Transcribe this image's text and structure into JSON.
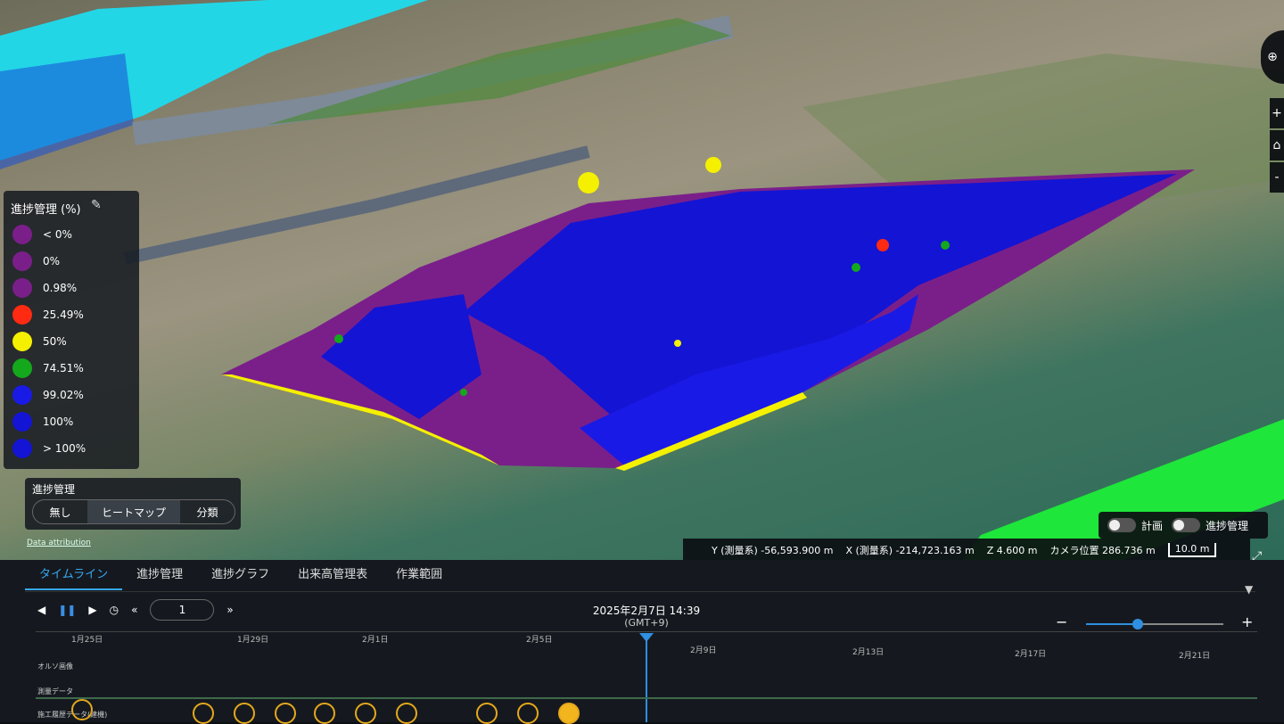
{
  "legend": {
    "title": "進捗管理 (%)",
    "items": [
      {
        "label": "< 0%",
        "color": "#7a1f8a"
      },
      {
        "label": "0%",
        "color": "#7a1f8a"
      },
      {
        "label": "0.98%",
        "color": "#7a1f8a"
      },
      {
        "label": "25.49%",
        "color": "#ff2a12"
      },
      {
        "label": "50%",
        "color": "#f4f000"
      },
      {
        "label": "74.51%",
        "color": "#14a81c"
      },
      {
        "label": "99.02%",
        "color": "#1a1ae6"
      },
      {
        "label": "100%",
        "color": "#1414d4"
      },
      {
        "label": "> 100%",
        "color": "#1414d4"
      }
    ]
  },
  "progress_mode": {
    "label": "進捗管理",
    "options": [
      "無し",
      "ヒートマップ",
      "分類"
    ],
    "selected": "ヒートマップ"
  },
  "attribution": "Data attribution",
  "coords": {
    "y": "Y (測量系) -56,593.900 m",
    "x": "X (測量系) -214,723.163 m",
    "z": "Z 4.600 m",
    "camera": "カメラ位置 286.736 m",
    "scale": "10.0 m"
  },
  "toggles": {
    "plan": "計画",
    "progress": "進捗管理"
  },
  "tabs": [
    "タイムライン",
    "進捗管理",
    "進捗グラフ",
    "出来高管理表",
    "作業範囲"
  ],
  "active_tab": "タイムライン",
  "timeline": {
    "step_value": "1",
    "current_date": "2025年2月7日 14:39",
    "timezone": "(GMT+9)",
    "ticks": [
      "1月25日",
      "1月29日",
      "2月1日",
      "2月5日",
      "2月9日",
      "2月13日",
      "2月17日",
      "2月21日"
    ],
    "rows": [
      "オルソ画像",
      "測量データ",
      "施工履歴データ(建機)"
    ]
  },
  "colors": {
    "accent": "#2f8fe0",
    "marker": "#f2b51d"
  }
}
